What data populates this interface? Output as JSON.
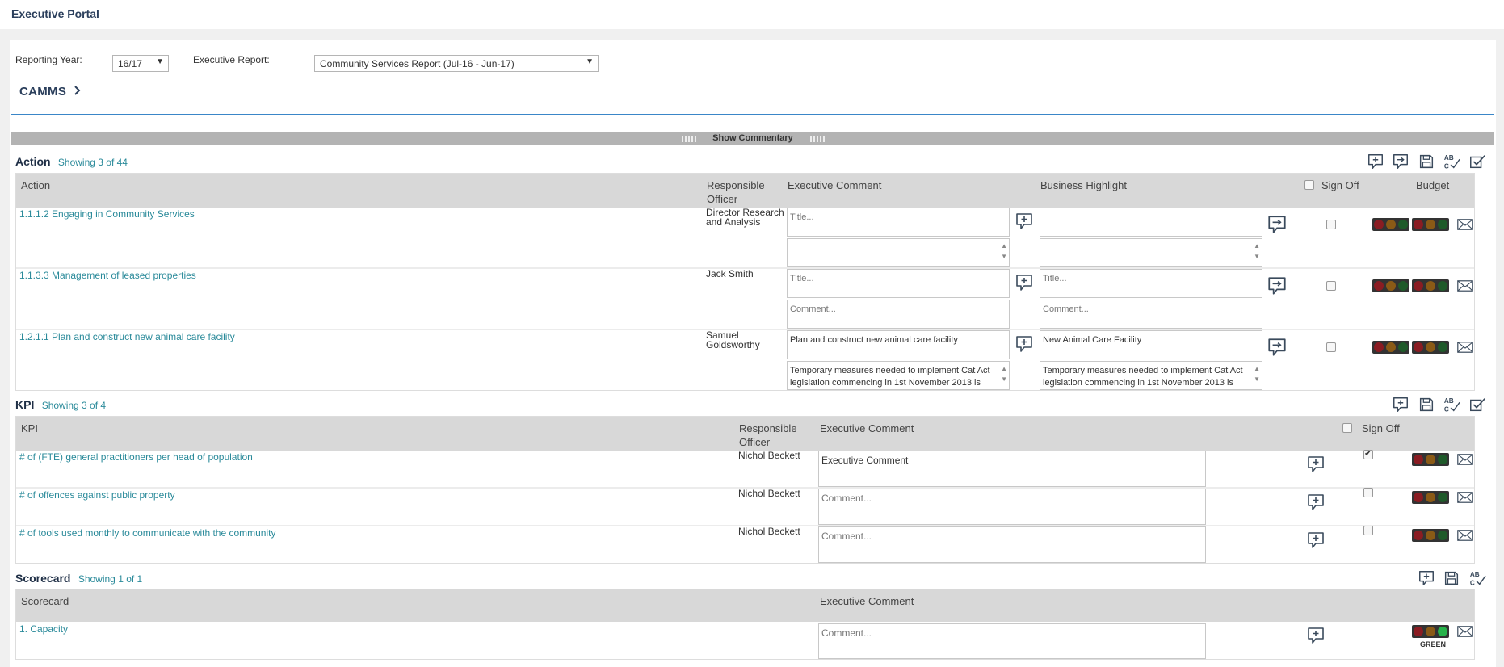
{
  "app": {
    "title": "Executive Portal"
  },
  "filters": {
    "reporting_year_label": "Reporting Year:",
    "reporting_year_value": "16/17",
    "executive_report_label": "Executive Report:",
    "executive_report_value": "Community Services Report (Jul-16 - Jun-17)"
  },
  "breadcrumb": {
    "label": "CAMMS"
  },
  "commentary_bar": {
    "label": "Show Commentary"
  },
  "action": {
    "title": "Action",
    "count": "Showing 3 of 44",
    "columns": {
      "name": "Action",
      "officer": "Responsible Officer",
      "exec_comment": "Executive Comment",
      "business_highlight": "Business Highlight",
      "sign_off": "Sign Off",
      "budget": "Budget"
    },
    "rows": [
      {
        "name": "1.1.1.2 Engaging in Community Services",
        "officer": "Director Research and Analysis",
        "exec_title": "",
        "exec_title_placeholder": "Title...",
        "exec_comment": "",
        "exec_comment_placeholder": "",
        "bh_title": "",
        "bh_title_placeholder": "",
        "bh_comment": "",
        "bh_comment_placeholder": "",
        "signed": false
      },
      {
        "name": "1.1.3.3 Management of leased properties",
        "officer": "Jack Smith",
        "exec_title": "",
        "exec_title_placeholder": "Title...",
        "exec_comment": "",
        "exec_comment_placeholder": "Comment...",
        "bh_title": "",
        "bh_title_placeholder": "Title...",
        "bh_comment": "",
        "bh_comment_placeholder": "Comment...",
        "signed": false
      },
      {
        "name": "1.2.1.1 Plan and construct new animal care facility",
        "officer": "Samuel Goldsworthy",
        "exec_title": "Plan and construct new animal care facility",
        "exec_title_placeholder": "",
        "exec_comment": "Temporary measures needed to implement Cat Act legislation commencing in 1st November 2013 is",
        "exec_comment_placeholder": "",
        "bh_title": "New Animal Care Facility",
        "bh_title_placeholder": "",
        "bh_comment": "Temporary measures needed to implement Cat Act legislation commencing in 1st November 2013 is",
        "bh_comment_placeholder": "",
        "signed": false
      }
    ]
  },
  "kpi": {
    "title": "KPI",
    "count": "Showing 3 of 4",
    "columns": {
      "name": "KPI",
      "officer": "Responsible Officer",
      "exec_comment": "Executive Comment",
      "sign_off": "Sign Off"
    },
    "rows": [
      {
        "name": "# of (FTE) general practitioners per head of population",
        "officer": "Nichol Beckett",
        "comment": "Executive Comment",
        "placeholder": "",
        "signed": true
      },
      {
        "name": "# of offences against public property",
        "officer": "Nichol Beckett",
        "comment": "",
        "placeholder": "Comment...",
        "signed": false
      },
      {
        "name": "# of tools used monthly to communicate with the community",
        "officer": "Nichol Beckett",
        "comment": "",
        "placeholder": "Comment...",
        "signed": false
      }
    ]
  },
  "scorecard": {
    "title": "Scorecard",
    "count": "Showing 1 of 1",
    "columns": {
      "name": "Scorecard",
      "exec_comment": "Executive Comment"
    },
    "rows": [
      {
        "name": "1. Capacity",
        "comment": "",
        "placeholder": "Comment...",
        "status": "GREEN"
      }
    ]
  },
  "icons": {
    "add_comment": "add-comment-icon",
    "copy_comment": "copy-comment-icon",
    "save": "save-icon",
    "spellcheck": "spellcheck-icon",
    "sign_off_all": "sign-off-all-icon",
    "email": "email-icon",
    "traffic_light": "traffic-light-icon"
  },
  "colors": {
    "link": "#2a8a9a",
    "header_bg": "#d8d8d8",
    "accent_line": "#3a86c8",
    "light_red": "#8a1c22",
    "light_amber": "#8a5a16",
    "light_green_dim": "#1f5a2a",
    "light_green_on": "#27b24a"
  }
}
